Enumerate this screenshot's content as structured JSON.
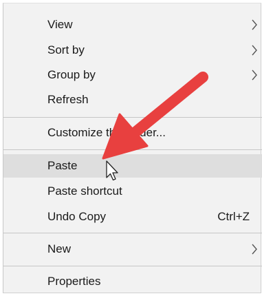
{
  "menu": {
    "items": [
      {
        "label": "View",
        "submenu": true
      },
      {
        "label": "Sort by",
        "submenu": true
      },
      {
        "label": "Group by",
        "submenu": true
      },
      {
        "label": "Refresh"
      },
      {
        "label": "Customize this folder..."
      },
      {
        "label": "Paste",
        "highlighted": true
      },
      {
        "label": "Paste shortcut"
      },
      {
        "label": "Undo Copy",
        "shortcut": "Ctrl+Z"
      },
      {
        "label": "New",
        "submenu": true
      },
      {
        "label": "Properties"
      }
    ]
  },
  "annotation": {
    "arrow_color": "#e8403f",
    "pointer_icon": "arrow-cursor-icon"
  },
  "colors": {
    "menu_background": "#f2f2f2",
    "highlight": "#dedede",
    "separator": "#c6c6c6",
    "text": "#1a1a1a"
  }
}
